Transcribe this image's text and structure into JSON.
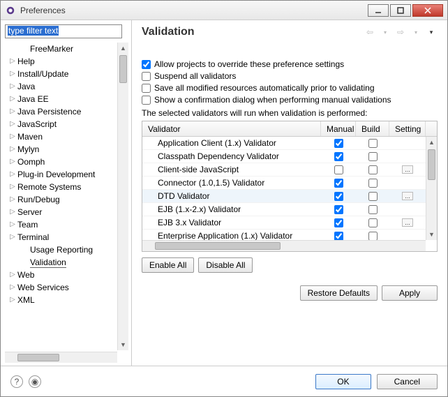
{
  "window": {
    "title": "Preferences"
  },
  "sidebar": {
    "filter_placeholder": "type filter text",
    "items": [
      {
        "label": "FreeMarker",
        "expander": "",
        "indent": 1
      },
      {
        "label": "Help",
        "expander": "▷"
      },
      {
        "label": "Install/Update",
        "expander": "▷"
      },
      {
        "label": "Java",
        "expander": "▷"
      },
      {
        "label": "Java EE",
        "expander": "▷"
      },
      {
        "label": "Java Persistence",
        "expander": "▷"
      },
      {
        "label": "JavaScript",
        "expander": "▷"
      },
      {
        "label": "Maven",
        "expander": "▷"
      },
      {
        "label": "Mylyn",
        "expander": "▷"
      },
      {
        "label": "Oomph",
        "expander": "▷"
      },
      {
        "label": "Plug-in Development",
        "expander": "▷"
      },
      {
        "label": "Remote Systems",
        "expander": "▷"
      },
      {
        "label": "Run/Debug",
        "expander": "▷"
      },
      {
        "label": "Server",
        "expander": "▷"
      },
      {
        "label": "Team",
        "expander": "▷"
      },
      {
        "label": "Terminal",
        "expander": "▷"
      },
      {
        "label": "Usage Reporting",
        "expander": "",
        "indent": 1
      },
      {
        "label": "Validation",
        "expander": "",
        "indent": 1,
        "selected": true
      },
      {
        "label": "Web",
        "expander": "▷"
      },
      {
        "label": "Web Services",
        "expander": "▷"
      },
      {
        "label": "XML",
        "expander": "▷"
      }
    ]
  },
  "main": {
    "title": "Validation",
    "options": [
      {
        "label": "Allow projects to override these preference settings",
        "checked": true
      },
      {
        "label": "Suspend all validators",
        "checked": false
      },
      {
        "label": "Save all modified resources automatically prior to validating",
        "checked": false
      },
      {
        "label": "Show a confirmation dialog when performing manual validations",
        "checked": false
      }
    ],
    "note": "The selected validators will run when validation is performed:",
    "columns": {
      "validator": "Validator",
      "manual": "Manual",
      "build": "Build",
      "settings": "Setting"
    },
    "rows": [
      {
        "name": "Application Client (1.x) Validator",
        "manual": true,
        "build": false,
        "dots": false
      },
      {
        "name": "Classpath Dependency Validator",
        "manual": true,
        "build": false,
        "dots": false
      },
      {
        "name": "Client-side JavaScript",
        "manual": false,
        "build": false,
        "dots": true
      },
      {
        "name": "Connector (1.0,1.5) Validator",
        "manual": true,
        "build": false,
        "dots": false
      },
      {
        "name": "DTD Validator",
        "manual": true,
        "build": false,
        "dots": true,
        "selected": true
      },
      {
        "name": "EJB (1.x-2.x) Validator",
        "manual": true,
        "build": false,
        "dots": false
      },
      {
        "name": "EJB 3.x Validator",
        "manual": true,
        "build": false,
        "dots": true
      },
      {
        "name": "Enterprise Application (1.x) Validator",
        "manual": true,
        "build": false,
        "dots": false
      }
    ],
    "buttons": {
      "enable_all": "Enable All",
      "disable_all": "Disable All",
      "restore": "Restore Defaults",
      "apply": "Apply"
    }
  },
  "footer": {
    "ok": "OK",
    "cancel": "Cancel"
  }
}
